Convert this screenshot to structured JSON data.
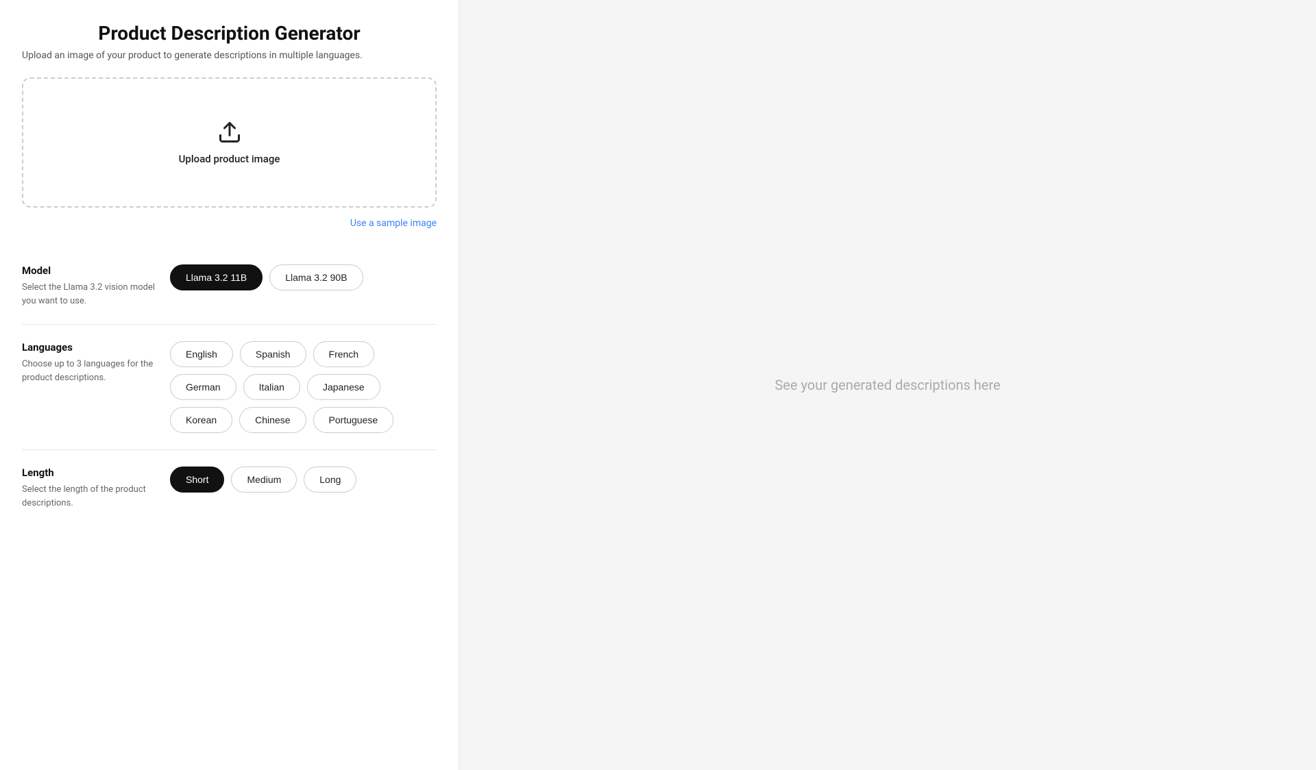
{
  "header": {
    "title": "Product Description Generator",
    "subtitle": "Upload an image of your product to generate descriptions in multiple languages."
  },
  "upload": {
    "label": "Upload product image",
    "sample_link": "Use a sample image"
  },
  "model_section": {
    "title": "Model",
    "description": "Select the Llama 3.2 vision model you want to use.",
    "options": [
      {
        "id": "11b",
        "label": "Llama 3.2 11B",
        "active": true
      },
      {
        "id": "90b",
        "label": "Llama 3.2 90B",
        "active": false
      }
    ]
  },
  "languages_section": {
    "title": "Languages",
    "description": "Choose up to 3 languages for the product descriptions.",
    "options_row1": [
      {
        "id": "english",
        "label": "English",
        "active": false
      },
      {
        "id": "spanish",
        "label": "Spanish",
        "active": false
      },
      {
        "id": "french",
        "label": "French",
        "active": false
      }
    ],
    "options_row2": [
      {
        "id": "german",
        "label": "German",
        "active": false
      },
      {
        "id": "italian",
        "label": "Italian",
        "active": false
      },
      {
        "id": "japanese",
        "label": "Japanese",
        "active": false
      }
    ],
    "options_row3": [
      {
        "id": "korean",
        "label": "Korean",
        "active": false
      },
      {
        "id": "chinese",
        "label": "Chinese",
        "active": false
      },
      {
        "id": "portuguese",
        "label": "Portuguese",
        "active": false
      }
    ]
  },
  "length_section": {
    "title": "Length",
    "description": "Select the length of the product descriptions.",
    "options": [
      {
        "id": "short",
        "label": "Short",
        "active": true
      },
      {
        "id": "medium",
        "label": "Medium",
        "active": false
      },
      {
        "id": "long",
        "label": "Long",
        "active": false
      }
    ]
  },
  "right_panel": {
    "placeholder": "See your generated descriptions here"
  }
}
